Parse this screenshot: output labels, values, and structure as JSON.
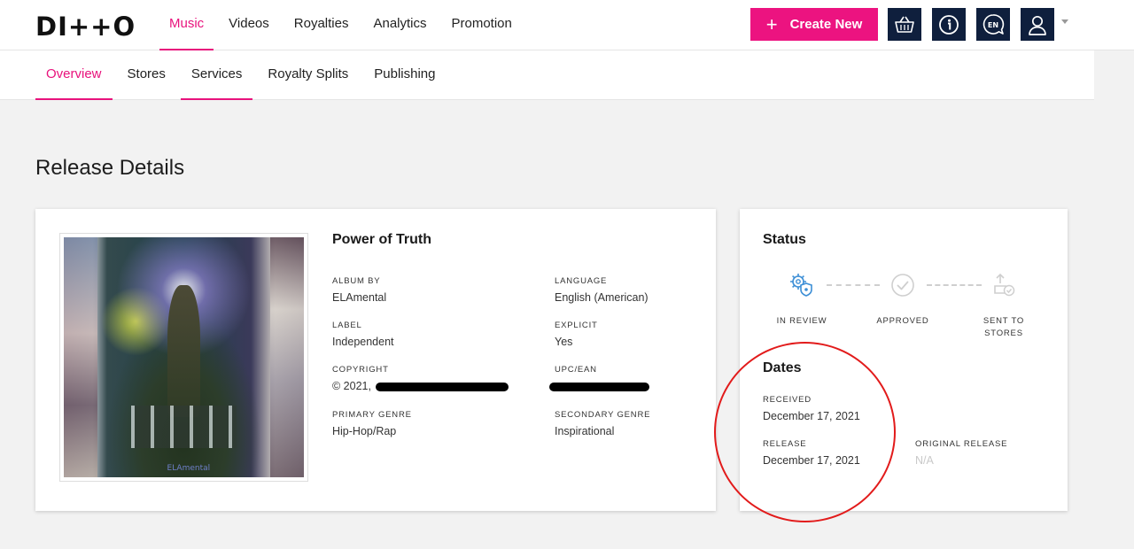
{
  "app": {
    "logo_text": "DI++O"
  },
  "main_nav": {
    "items": [
      {
        "label": "Music",
        "active": true
      },
      {
        "label": "Videos",
        "active": false
      },
      {
        "label": "Royalties",
        "active": false
      },
      {
        "label": "Analytics",
        "active": false
      },
      {
        "label": "Promotion",
        "active": false
      }
    ]
  },
  "header_actions": {
    "create_label": "Create New",
    "icons": [
      "basket-icon",
      "info-icon",
      "language-en-icon",
      "user-icon"
    ],
    "language_code": "EN"
  },
  "sub_nav": {
    "items": [
      {
        "label": "Overview",
        "active": true
      },
      {
        "label": "Stores",
        "active": false
      },
      {
        "label": "Services",
        "active": false
      },
      {
        "label": "Royalty Splits",
        "active": false
      },
      {
        "label": "Publishing",
        "active": false
      }
    ]
  },
  "page_title": "Release Details",
  "release": {
    "title": "Power of Truth",
    "artwork_signature": "ELAmental",
    "fields": {
      "album_by": {
        "label": "ALBUM BY",
        "value": "ELAmental"
      },
      "language": {
        "label": "LANGUAGE",
        "value": "English (American)"
      },
      "label": {
        "label": "LABEL",
        "value": "Independent"
      },
      "explicit": {
        "label": "EXPLICIT",
        "value": "Yes"
      },
      "copyright": {
        "label": "COPYRIGHT",
        "value": "© 2021,"
      },
      "upc": {
        "label": "UPC/EAN",
        "value": ""
      },
      "primary_genre": {
        "label": "PRIMARY GENRE",
        "value": "Hip-Hop/Rap"
      },
      "secondary_genre": {
        "label": "SECONDARY GENRE",
        "value": "Inspirational"
      }
    }
  },
  "status": {
    "title": "Status",
    "steps": [
      {
        "label": "IN REVIEW",
        "icon": "gears-shield-icon",
        "state": "current"
      },
      {
        "label": "APPROVED",
        "icon": "check-circle-icon",
        "state": "pending"
      },
      {
        "label": "SENT TO STORES",
        "icon": "send-to-stores-icon",
        "state": "pending"
      }
    ]
  },
  "dates": {
    "title": "Dates",
    "received": {
      "label": "RECEIVED",
      "value": "December 17, 2021"
    },
    "release": {
      "label": "RELEASE",
      "value": "December 17, 2021"
    },
    "original_release": {
      "label": "ORIGINAL RELEASE",
      "value": "N/A"
    }
  },
  "colors": {
    "accent": "#e8127c",
    "button_pink": "#ec1380",
    "navy": "#0f1f3d",
    "status_blue": "#3d8fd6",
    "annotation_red": "#e21b1b"
  }
}
